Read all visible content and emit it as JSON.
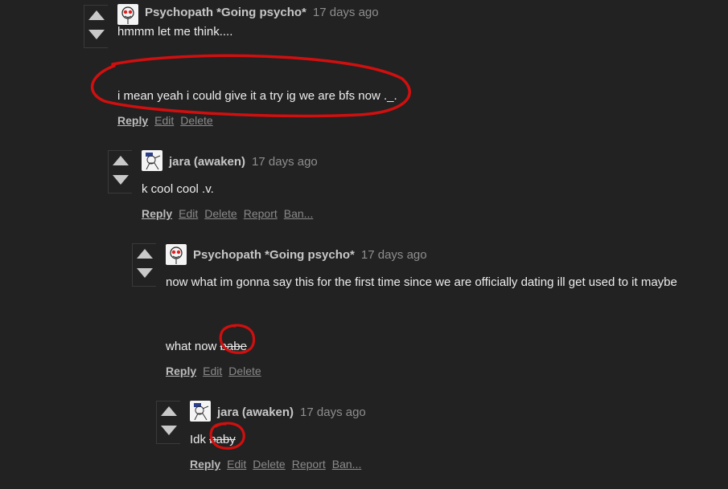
{
  "comments": [
    {
      "author": "Psychopath *Going psycho*",
      "time": "17 days ago",
      "line1": "hmmm let me think....",
      "line2": "i mean yeah i could give it a try ig we are bfs now ._.",
      "actions": [
        "Reply",
        "Edit",
        "Delete"
      ]
    },
    {
      "author": "jara (awaken)",
      "time": "17 days ago",
      "line1": "k cool cool  .v.",
      "actions": [
        "Reply",
        "Edit",
        "Delete",
        "Report",
        "Ban..."
      ]
    },
    {
      "author": "Psychopath *Going psycho*",
      "time": "17 days ago",
      "line1": "now what im gonna say this for the first time since we are officially dating ill get used to it maybe",
      "line2_prefix": "what now ",
      "line2_struck": "babe",
      "actions": [
        "Reply",
        "Edit",
        "Delete"
      ]
    },
    {
      "author": "jara (awaken)",
      "time": "17 days ago",
      "line1_prefix": "Idk ",
      "line1_struck": "baby",
      "actions": [
        "Reply",
        "Edit",
        "Delete",
        "Report",
        "Ban..."
      ]
    }
  ],
  "colors": {
    "background": "#222222",
    "annotation": "#d10f0f"
  }
}
